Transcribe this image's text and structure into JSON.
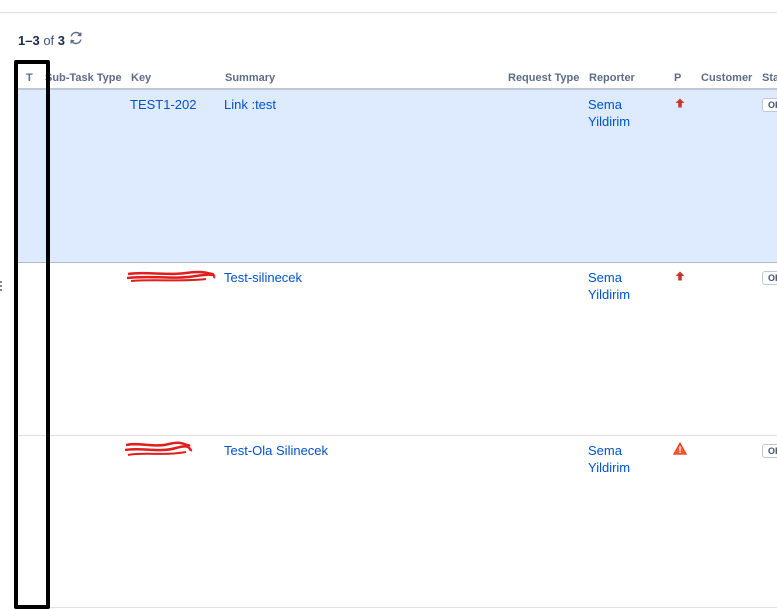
{
  "results": {
    "range": "1–3",
    "of_label": "of",
    "total": "3"
  },
  "columns": {
    "type": "T",
    "subtask_type": "Sub-Task Type",
    "key": "Key",
    "summary": "Summary",
    "request_type": "Request Type",
    "reporter": "Reporter",
    "priority": "P",
    "customer": "Customer",
    "status": "Sta"
  },
  "rows": [
    {
      "key": "TEST1-202",
      "summary": "Link :test",
      "reporter": "Sema Yildirim",
      "priority_icon": "priority-high-arrow-icon",
      "status": "OPEN"
    },
    {
      "key": "",
      "summary": "Test-silinecek",
      "reporter": "Sema Yildirim",
      "priority_icon": "priority-high-arrow-icon",
      "status": "OPEN"
    },
    {
      "key": "",
      "summary": "Test-Ola Silinecek",
      "reporter": "Sema Yildirim",
      "priority_icon": "priority-warning-triangle-icon",
      "status": "OPEN"
    }
  ],
  "colors": {
    "link": "#0052cc",
    "selected_row": "#deebff",
    "priority_red": "#c9372c",
    "warning": "#ff5630",
    "annotation": "#000000",
    "redaction": "#e01e1e"
  }
}
